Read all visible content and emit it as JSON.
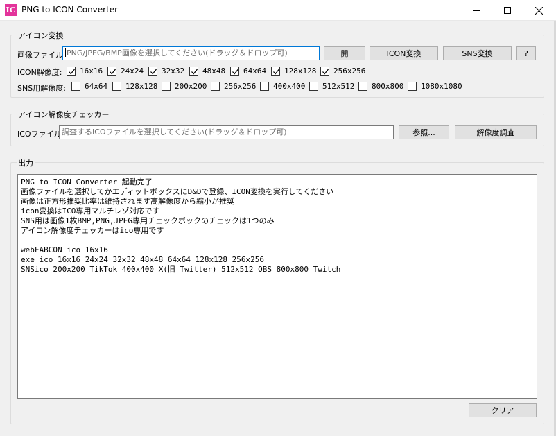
{
  "window": {
    "icon_text": "IC",
    "title": "PNG to ICON Converter"
  },
  "converter_group": {
    "label": "アイコン変換",
    "image_file_label": "画像ファイル:",
    "image_file_placeholder": "PNG/JPEG/BMP画像を選択してください(ドラッグ＆ドロップ可)",
    "open_button": "開",
    "icon_convert_button": "ICON変換",
    "sns_convert_button": "SNS変換",
    "help_button": "?",
    "icon_resolution_label": "ICON解像度:",
    "icon_sizes": [
      {
        "label": "16x16",
        "checked": true
      },
      {
        "label": "24x24",
        "checked": true
      },
      {
        "label": "32x32",
        "checked": true
      },
      {
        "label": "48x48",
        "checked": true
      },
      {
        "label": "64x64",
        "checked": true
      },
      {
        "label": "128x128",
        "checked": true
      },
      {
        "label": "256x256",
        "checked": true
      }
    ],
    "sns_resolution_label": "SNS用解像度:",
    "sns_sizes": [
      {
        "label": "64x64",
        "checked": false
      },
      {
        "label": "128x128",
        "checked": false
      },
      {
        "label": "200x200",
        "checked": false
      },
      {
        "label": "256x256",
        "checked": false
      },
      {
        "label": "400x400",
        "checked": false
      },
      {
        "label": "512x512",
        "checked": false
      },
      {
        "label": "800x800",
        "checked": false
      },
      {
        "label": "1080x1080",
        "checked": false
      }
    ]
  },
  "checker_group": {
    "label": "アイコン解像度チェッカー",
    "ico_file_label": "ICOファイル:",
    "ico_file_placeholder": "調査するICOファイルを選択してください(ドラッグ＆ドロップ可)",
    "browse_button": "参照...",
    "inspect_button": "解像度調査"
  },
  "output_group": {
    "label": "出力",
    "lines": [
      "PNG to ICON Converter 起動完了",
      "画像ファイルを選択してかエディットボックスにD&Dで登録、ICON変換を実行してください",
      "画像は正方形推奨比率は維持されます高解像度から縮小が推奨",
      "icon変換はICO専用マルチレゾ対応です",
      "SNS用は画像1枚BMP,PNG,JPEG専用チェックボックのチェックは1つのみ",
      "アイコン解像度チェッカーはico専用です",
      "",
      "webFABCON ico 16x16",
      "exe ico 16x16 24x24 32x32 48x48 64x64 128x128 256x256",
      "SNSico 200x200 TikTok 400x400 X(旧 Twitter) 512x512 OBS 800x800 Twitch"
    ],
    "clear_button": "クリア"
  }
}
